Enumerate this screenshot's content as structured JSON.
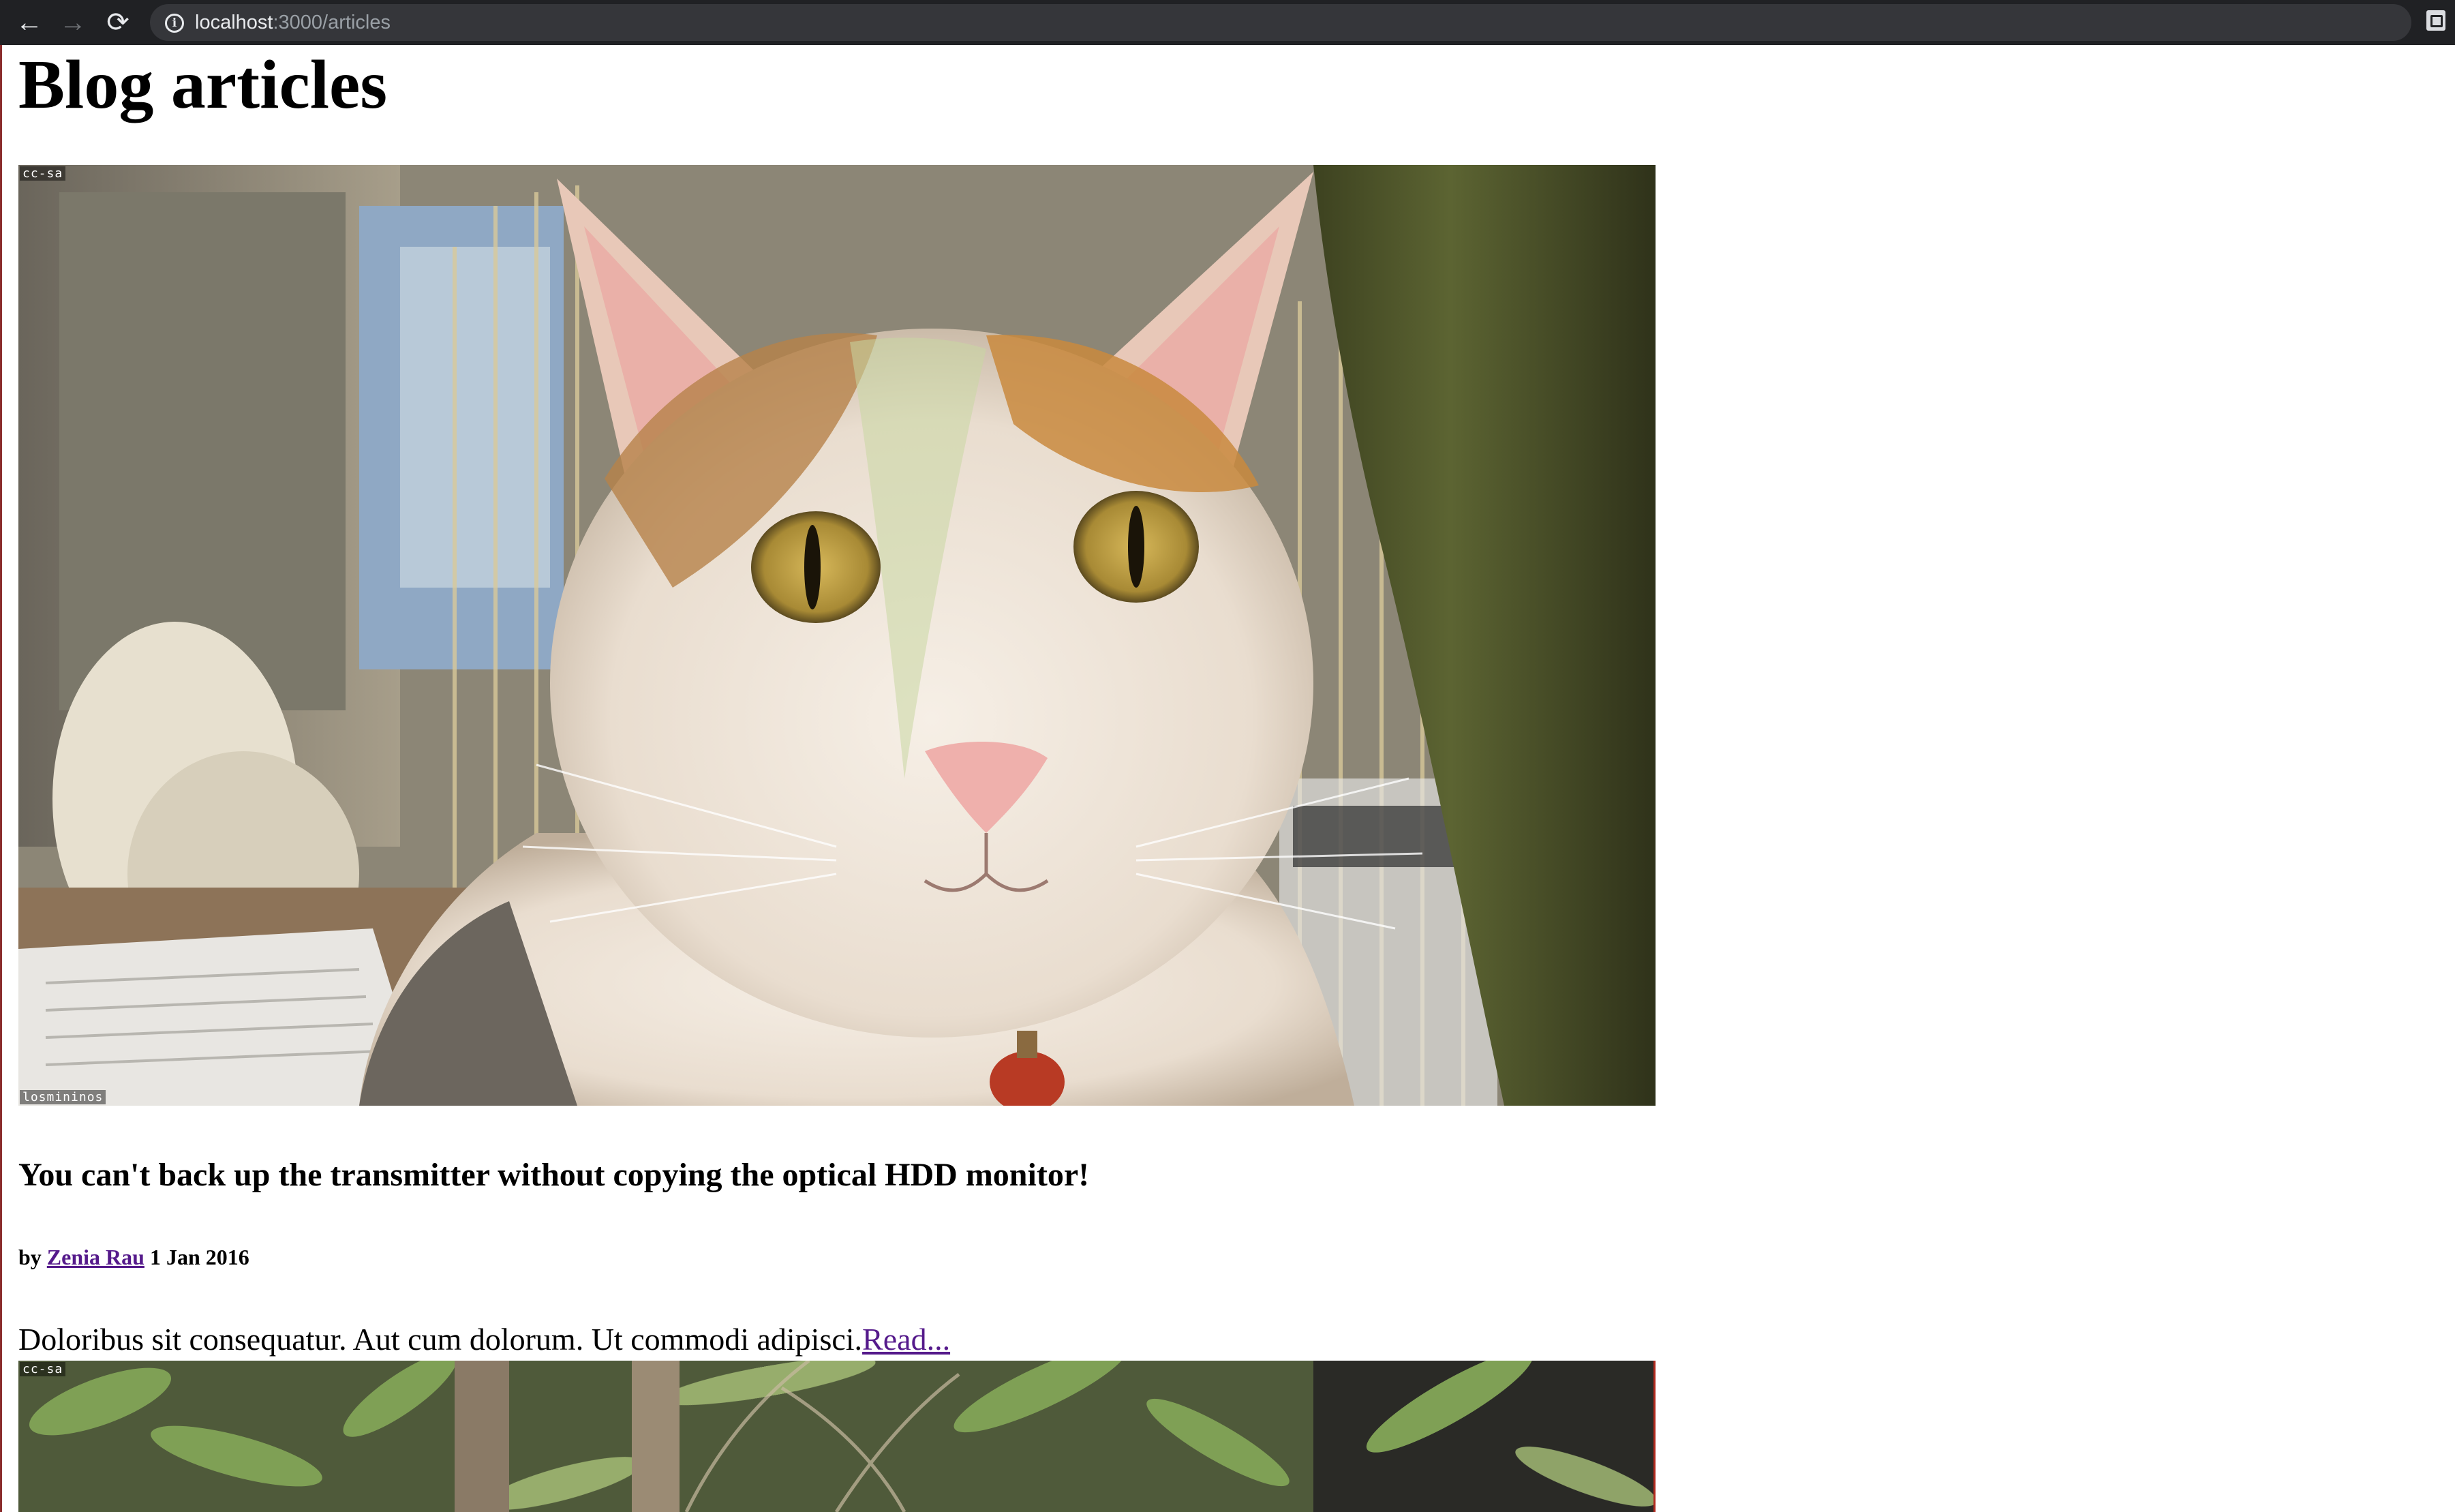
{
  "browser": {
    "url_host": "localhost",
    "url_path": ":3000/articles",
    "back_icon": "←",
    "forward_icon": "→",
    "reload_icon": "⟳",
    "info_icon": "i"
  },
  "page": {
    "title": "Blog articles"
  },
  "articles": [
    {
      "image_tag_top": "cc-sa",
      "image_tag_bottom": "losmininos",
      "title": "You can't back up the transmitter without copying the optical HDD monitor!",
      "by_label": "by",
      "author": "Zenia Rau",
      "date": "1 Jan 2016",
      "excerpt": "Doloribus sit consequatur. Aut cum dolorum. Ut commodi adipisci.",
      "read_more": "Read..."
    },
    {
      "image_tag_top": "cc-sa"
    }
  ]
}
